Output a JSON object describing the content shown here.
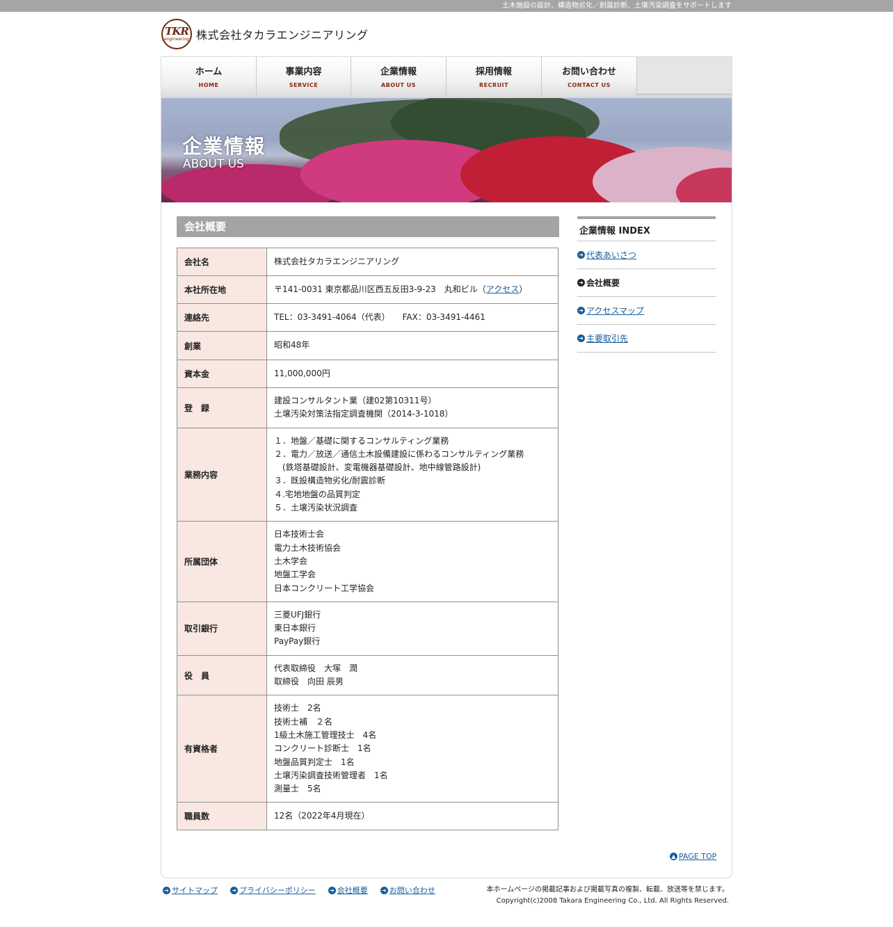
{
  "topbar": {
    "tagline": "土木施設の設計、構造物劣化／耐震診断、土壌汚染調査をサポートします"
  },
  "logo": {
    "mark": "TKR",
    "mark_sub": "engineering",
    "company": "株式会社タカラエンジニアリング"
  },
  "nav": [
    {
      "jp": "ホーム",
      "en": "HOME"
    },
    {
      "jp": "事業内容",
      "en": "SERVICE"
    },
    {
      "jp": "企業情報",
      "en": "ABOUT US"
    },
    {
      "jp": "採用情報",
      "en": "RECRUIT"
    },
    {
      "jp": "お問い合わせ",
      "en": "CONTACT US"
    }
  ],
  "hero": {
    "title": "企業情報",
    "subtitle": "ABOUT US"
  },
  "section_title": "会社概要",
  "table": {
    "name": {
      "label": "会社名",
      "value": "株式会社タカラエンジニアリング"
    },
    "address": {
      "label": "本社所在地",
      "value": "〒141-0031 東京都品川区西五反田3-9-23　丸和ビル（",
      "link": "アクセス",
      "close": "）"
    },
    "contact": {
      "label": "連絡先",
      "value": "TEL：03-3491-4064（代表）　　FAX：03-3491-4461"
    },
    "founded": {
      "label": "創業",
      "value": "昭和48年"
    },
    "capital": {
      "label": "資本金",
      "value": "11,000,000円"
    },
    "registration": {
      "label": "登　録",
      "lines": [
        "建設コンサルタント業（建02第10311号）",
        "土壌汚染対策法指定調査機関（2014-3-1018）"
      ]
    },
    "business": {
      "label": "業務内容",
      "lines": [
        "１．地盤／基礎に関するコンサルティング業務",
        "２．電力／放送／通信土木設備建設に係わるコンサルティング業務",
        "　(鉄塔基礎設計、変電機器基礎設計、地中線管路設計)",
        "３．既設構造物劣化/耐震診断",
        "４.宅地地盤の品質判定",
        "５．土壌汚染状況調査"
      ]
    },
    "associations": {
      "label": "所属団体",
      "lines": [
        "日本技術士会",
        "電力土木技術協会",
        "土木学会",
        "地盤工学会",
        "日本コンクリート工学協会"
      ]
    },
    "banks": {
      "label": "取引銀行",
      "lines": [
        "三菱UFJ銀行",
        "東日本銀行",
        "PayPay銀行"
      ]
    },
    "officers": {
      "label": "役　員",
      "lines": [
        "代表取締役　大塚　潤",
        "取締役　向田 辰男"
      ]
    },
    "qualified": {
      "label": "有資格者",
      "lines": [
        "技術士　2名",
        "技術士補　２名",
        "1級土木施工管理技士　4名",
        "コンクリート診断士　1名",
        "地盤品質判定士　1名",
        "土壌汚染調査技術管理者　1名",
        "測量士　5名"
      ]
    },
    "staff": {
      "label": "職員数",
      "value": "12名（2022年4月現在）"
    }
  },
  "sidebar": {
    "title": "企業情報 INDEX",
    "items": [
      {
        "label": "代表あいさつ"
      },
      {
        "label": "会社概要"
      },
      {
        "label": "アクセスマップ"
      },
      {
        "label": "主要取引先"
      }
    ]
  },
  "page_top": "PAGE TOP",
  "footer": {
    "links": [
      {
        "label": "サイトマップ"
      },
      {
        "label": "プライバシーポリシー"
      },
      {
        "label": "会社概要"
      },
      {
        "label": "お問い合わせ"
      }
    ],
    "notice": "本ホームページの掲載記事および掲載写真の複製、転載、放送等を禁じます。",
    "copyright": "Copyright(c)2008 Takara Engineering Co., Ltd. All Rights Reserved."
  },
  "colors": {
    "accent": "#1a5c99",
    "header_gray": "#a4a4a4",
    "label_bg": "#f8e8e1",
    "brand": "#6b2b12"
  }
}
